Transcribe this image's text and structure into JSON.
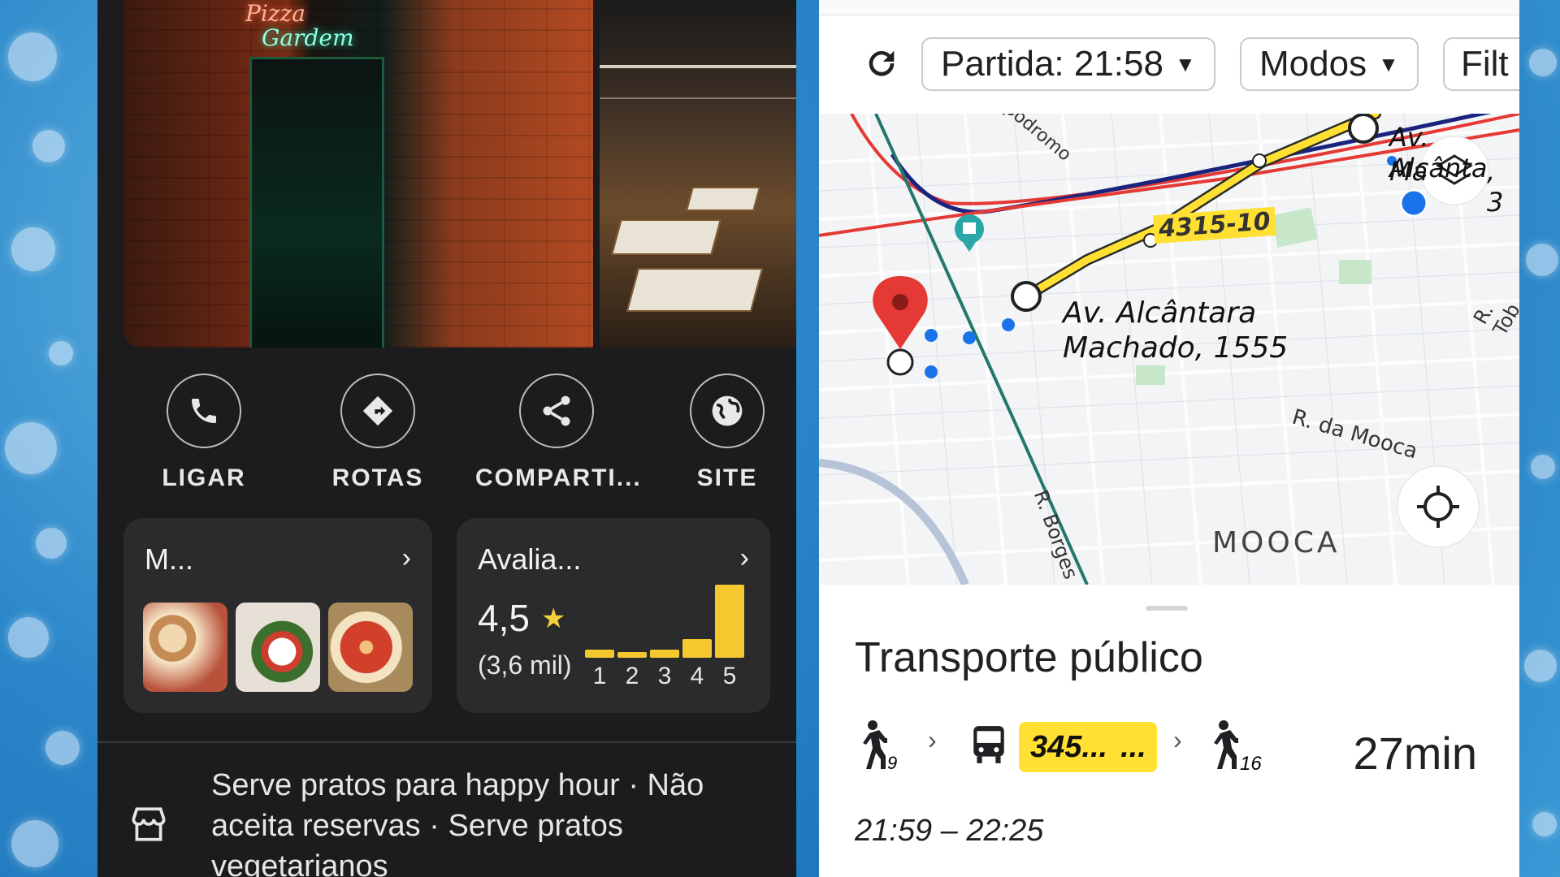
{
  "left": {
    "photos": {
      "neon_top": "Pizza",
      "neon_bottom": "Gardem"
    },
    "actions": [
      {
        "label": "LIGAR",
        "icon": "phone-icon"
      },
      {
        "label": "ROTAS",
        "icon": "directions-icon"
      },
      {
        "label": "COMPARTI...",
        "icon": "share-icon"
      },
      {
        "label": "SITE",
        "icon": "globe-icon"
      }
    ],
    "menu_card": {
      "title": "M...",
      "chevron": "›"
    },
    "reviews_card": {
      "title": "Avalia...",
      "chevron": "›",
      "rating": "4,5",
      "star": "★",
      "count": "(3,6 mil)",
      "distribution": {
        "labels": [
          "1",
          "2",
          "3",
          "4",
          "5"
        ],
        "values": [
          0.06,
          0.04,
          0.06,
          0.14,
          0.55
        ]
      }
    },
    "description": "Serve pratos para happy hour · Não aceita reservas · Serve pratos vegetarianos"
  },
  "right": {
    "departure_chip": "Partida: 21:58",
    "modes_chip": "Modos",
    "filters_chip": "Filt",
    "map": {
      "route_badge": "4315-10",
      "stop_label_line1": "Av. Alcântara",
      "stop_label_line2": "Machado, 1555",
      "top_label_line1": "Av. Alcânta",
      "top_label_line2": "Ma",
      "top_label_suffix": ", 3",
      "street_rua_mooca": "R. da Mooca",
      "street_borges": "R. Borges de Fi",
      "street_tob": "R. Tob",
      "street_top": "pódromo",
      "neighborhood": "MOOCA"
    },
    "sheet": {
      "title": "Transporte público",
      "walk1": "9",
      "route_chip": "345...",
      "route_chip_more": "...",
      "walk2": "16",
      "duration": "27min",
      "times": "21:59 – 22:25"
    }
  },
  "colors": {
    "accent_yellow": "#f4c82e",
    "map_pin": "#e53935",
    "route_blue": "#1a73e8"
  }
}
